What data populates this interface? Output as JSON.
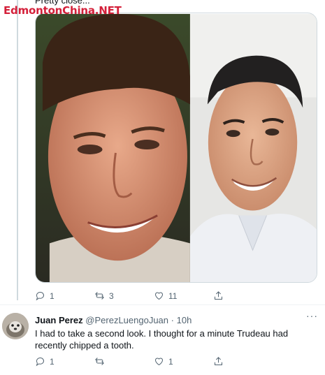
{
  "watermark": "EdmontonChina.NET",
  "previous_tweet": {
    "text": "Pretty close...",
    "actions": {
      "reply_count": "1",
      "retweet_count": "3",
      "like_count": "11"
    }
  },
  "reply": {
    "display_name": "Juan Perez",
    "handle": "@PerezLuengoJuan",
    "separator": "·",
    "time": "10h",
    "text": "I had to take a second look. I thought for a minute Trudeau had recently chipped a tooth.",
    "actions": {
      "reply_count": "1",
      "retweet_count": "",
      "like_count": "1"
    }
  },
  "colors": {
    "secondary_text": "#536471",
    "border": "#cfd9de",
    "watermark": "#d4203a"
  },
  "icons": [
    "reply-icon",
    "retweet-icon",
    "like-icon",
    "share-icon",
    "more-icon"
  ]
}
